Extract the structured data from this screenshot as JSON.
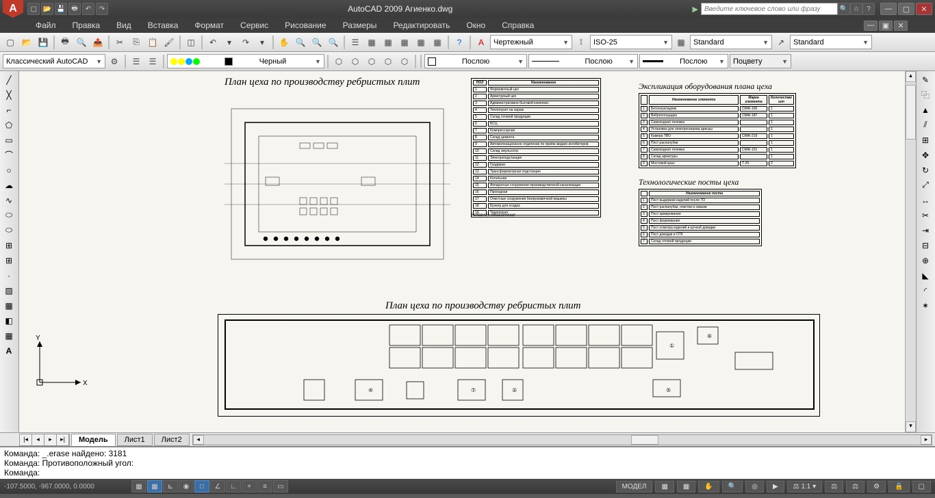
{
  "app": {
    "title": "AutoCAD 2009  Агиенко.dwg",
    "logo_letter": "A",
    "search_placeholder": "Введите ключевое слово или фразу"
  },
  "menu": {
    "items": [
      "Файл",
      "Правка",
      "Вид",
      "Вставка",
      "Формат",
      "Сервис",
      "Рисование",
      "Размеры",
      "Редактировать",
      "Окно",
      "Справка"
    ]
  },
  "workspace": {
    "value": "Классический AutoCAD"
  },
  "layer": {
    "current": "Черный"
  },
  "props": {
    "textstyle": "Чертежный",
    "dimstyle": "ISO-25",
    "tablestyle": "Standard",
    "mleaderstyle": "Standard",
    "color": "Послою",
    "linetype": "Послою",
    "lineweight": "Послою",
    "plotstyle": "Поцвету"
  },
  "tabs": {
    "model": "Модель",
    "sheets": [
      "Лист1",
      "Лист2"
    ]
  },
  "command": {
    "lines": [
      "Команда: _.erase найдено: 3181",
      "Команда: Противоположный угол:",
      "",
      "Команда:"
    ]
  },
  "status": {
    "coords": "-107.5000, -967.0000, 0.0000",
    "space": "МОДЕЛ",
    "scale": "1:1"
  },
  "drawing": {
    "title1": "План цеха по производству ребристых плит",
    "title2": "План цеха по производству ребристых плит",
    "explic_title": "Экспликация оборудования плана цеха",
    "tech_title": "Технологические посты цеха",
    "table_poz": "ПОЗ",
    "table_name": "Наименование",
    "explic_cols": [
      "Наименование элемента",
      "Марка элемента",
      "Количество шт"
    ],
    "tech_col": "Наименование поста",
    "ucs": {
      "x": "X",
      "y": "Y"
    },
    "legend_title": "Условные обозначения"
  }
}
